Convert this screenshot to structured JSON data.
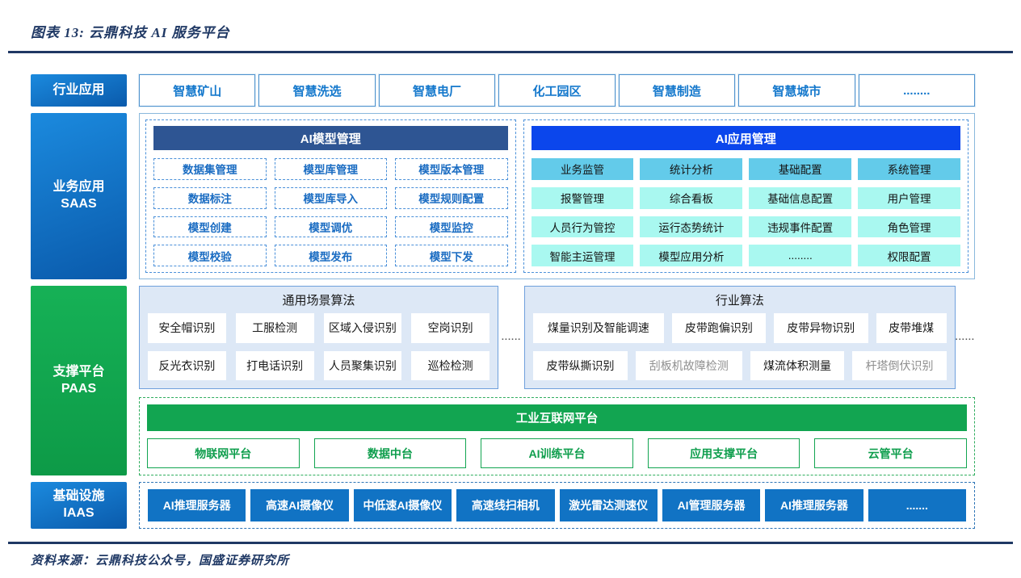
{
  "title": "图表 13:  云鼎科技 AI 服务平台",
  "source": "资料来源：云鼎科技公众号，国盛证券研究所",
  "colors": {
    "title_navy": "#1F3864",
    "label_blue": "#1177C8",
    "label_green": "#12A551",
    "model_header_navy": "#2E5593",
    "app_header_blue": "#0B46EC",
    "cyan_dark": "#63CBEA",
    "cyan_light": "#A9F8F0",
    "alg_section_bg": "#DDE8F6",
    "iaas_box_blue": "#1173C4"
  },
  "rows": {
    "industry": {
      "label": "行业应用",
      "items": [
        "智慧矿山",
        "智慧洗选",
        "智慧电厂",
        "化工园区",
        "智慧制造",
        "智慧城市",
        "........"
      ]
    },
    "saas": {
      "label": "业务应用",
      "sublabel": "SAAS",
      "model_mgmt": {
        "title": "AI模型管理",
        "items": [
          "数据集管理",
          "模型库管理",
          "模型版本管理",
          "数据标注",
          "模型库导入",
          "模型规则配置",
          "模型创建",
          "模型调优",
          "模型监控",
          "模型校验",
          "模型发布",
          "模型下发"
        ]
      },
      "app_mgmt": {
        "title": "AI应用管理",
        "items": [
          "业务监管",
          "统计分析",
          "基础配置",
          "系统管理",
          "报警管理",
          "综合看板",
          "基础信息配置",
          "用户管理",
          "人员行为管控",
          "运行态势统计",
          "违规事件配置",
          "角色管理",
          "智能主运管理",
          "模型应用分析",
          "........",
          "权限配置"
        ]
      }
    },
    "paas": {
      "label": "支撑平台",
      "sublabel": "PAAS",
      "general_alg": {
        "title": "通用场景算法",
        "items": [
          "安全帽识别",
          "工服检测",
          "区域入侵识别",
          "空岗识别",
          "反光衣识别",
          "打电话识别",
          "人员聚集识别",
          "巡检检测"
        ],
        "more": "......"
      },
      "industry_alg": {
        "title": "行业算法",
        "items": [
          "煤量识别及智能调速",
          "皮带跑偏识别",
          "皮带异物识别",
          "皮带堆煤",
          "皮带纵撕识别",
          "刮板机故障检测",
          "煤流体积测量",
          "杆塔倒伏识别"
        ],
        "more": "......"
      },
      "iiot": {
        "title": "工业互联网平台",
        "items": [
          "物联网平台",
          "数据中台",
          "AI训练平台",
          "应用支撑平台",
          "云管平台"
        ]
      }
    },
    "iaas": {
      "label": "基础设施",
      "sublabel": "IAAS",
      "items": [
        "AI推理服务器",
        "高速AI摄像仪",
        "中低速AI摄像仪",
        "高速线扫相机",
        "激光雷达测速仪",
        "AI管理服务器",
        "AI推理服务器",
        "......."
      ]
    }
  }
}
